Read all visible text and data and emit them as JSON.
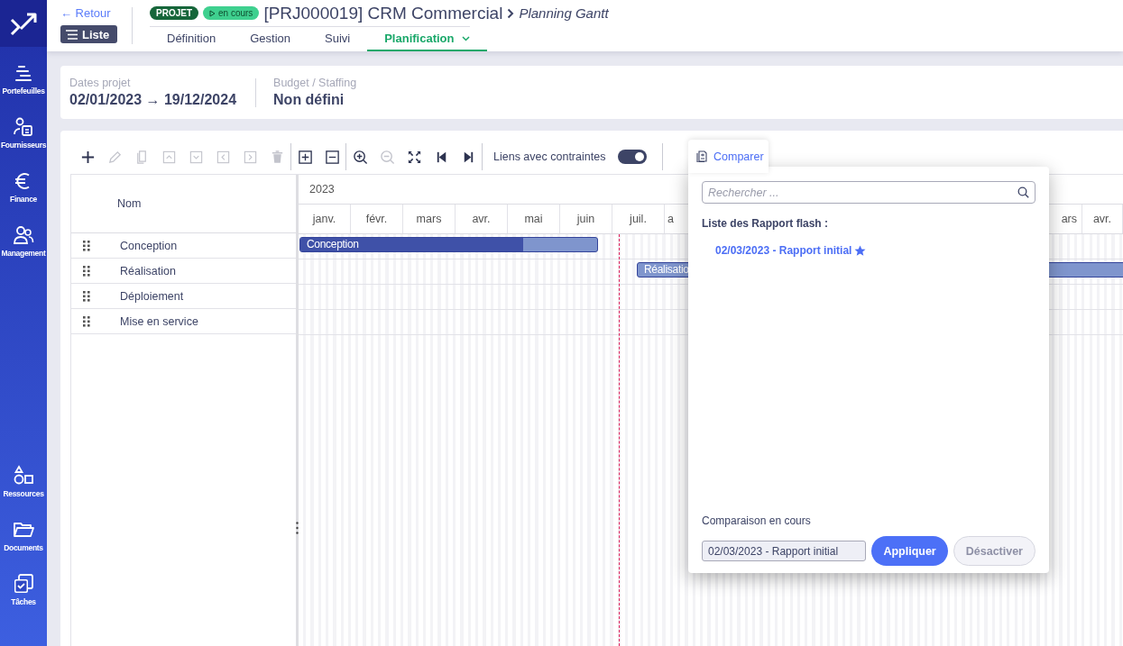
{
  "sidebar": {
    "top": [
      {
        "label": "Portefeuilles"
      },
      {
        "label": "Fournisseurs"
      },
      {
        "label": "Finance"
      },
      {
        "label": "Management"
      }
    ],
    "bottom": [
      {
        "label": "Ressources"
      },
      {
        "label": "Documents"
      },
      {
        "label": "Tâches"
      }
    ]
  },
  "header": {
    "back": "← Retour",
    "list_button": "Liste",
    "badges": [
      {
        "label": "PROJET",
        "kind": "type"
      },
      {
        "label": "en cours",
        "kind": "status"
      }
    ],
    "title": "[PRJ000019] CRM Commercial",
    "subtitle": "Planning Gantt",
    "tabs": [
      {
        "label": "Définition",
        "selected": false,
        "menu": false
      },
      {
        "label": "Gestion",
        "selected": false,
        "menu": false
      },
      {
        "label": "Suivi",
        "selected": false,
        "menu": false
      },
      {
        "label": "Planification",
        "selected": true,
        "menu": true
      }
    ]
  },
  "info": [
    {
      "label": "Dates projet",
      "value": "02/01/2023 → 19/12/2024"
    },
    {
      "label": "Budget / Staffing",
      "value": "Non défini"
    }
  ],
  "toolbar": {
    "groups": [
      {
        "buttons": [
          {
            "disabled": false
          },
          {
            "disabled": true
          },
          {
            "disabled": true
          },
          {
            "disabled": true
          },
          {
            "disabled": true
          },
          {
            "disabled": true
          },
          {
            "disabled": true
          },
          {
            "disabled": true
          }
        ]
      },
      {
        "buttons": [
          {
            "disabled": false
          },
          {
            "disabled": false
          }
        ]
      },
      {
        "buttons": [
          {
            "disabled": false
          },
          {
            "disabled": true
          },
          {
            "disabled": false
          },
          {
            "disabled": false
          },
          {
            "disabled": false
          }
        ]
      }
    ],
    "toggle": {
      "label": "Liens avec contraintes",
      "on": true
    },
    "compare": {
      "label": "Comparer",
      "expanded": true
    }
  },
  "gantt": {
    "column": "Nom",
    "rows": [
      {
        "name": "Conception"
      },
      {
        "name": "Réalisation"
      },
      {
        "name": "Déploiement"
      },
      {
        "name": "Mise en service"
      }
    ],
    "year": "2023",
    "months": [
      "janv.",
      "févr.",
      "mars",
      "avr.",
      "mai",
      "juin",
      "juil.",
      "a"
    ],
    "months_right": [
      "ars",
      "avr."
    ],
    "bars": [
      {
        "label": "Conception",
        "level": 0.75
      },
      {
        "label": "Réalisatio",
        "level": 0
      }
    ]
  },
  "compare_panel": {
    "search": {
      "placeholder": "Rechercher ..."
    },
    "list_title": "Liste des Rapport flash :",
    "reports": [
      {
        "label": "02/03/2023 - Rapport initial",
        "favorite": true
      }
    ],
    "current_title": "Comparaison en cours",
    "current": "02/03/2023 - Rapport initial",
    "buttons": [
      {
        "label": "Appliquer",
        "disabled": false
      },
      {
        "label": "Désactiver",
        "disabled": true
      }
    ]
  }
}
